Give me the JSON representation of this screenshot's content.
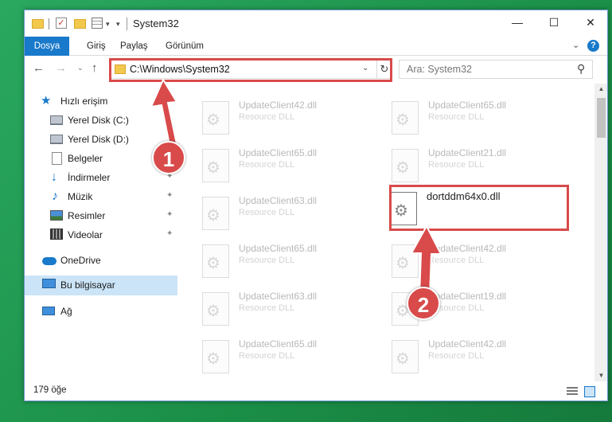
{
  "window": {
    "title": "System32",
    "controls": {
      "minimize": "—",
      "maximize": "☐",
      "close": "✕"
    },
    "quick_access_check": "✓"
  },
  "ribbon": {
    "tabs": [
      {
        "label": "Dosya",
        "active": true
      },
      {
        "label": "Giriş"
      },
      {
        "label": "Paylaş"
      },
      {
        "label": "Görünüm"
      }
    ],
    "help": "?",
    "collapse": "⌄"
  },
  "navbar": {
    "back": "←",
    "forward": "→",
    "recent": "⌄",
    "up": "↑",
    "address": "C:\\Windows\\System32",
    "address_dropdown": "⌄",
    "refresh": "↻",
    "search_placeholder": "Ara: System32",
    "search_icon": "⚲"
  },
  "sidebar": {
    "items": [
      {
        "label": "Hızlı erişim",
        "icon": "star-icon"
      },
      {
        "label": "Yerel Disk (C:)",
        "icon": "disk-icon",
        "pinned": true
      },
      {
        "label": "Yerel Disk (D:)",
        "icon": "disk-icon",
        "pinned": true
      },
      {
        "label": "Belgeler",
        "icon": "documents-icon",
        "pinned": true
      },
      {
        "label": "İndirmeler",
        "icon": "download-icon",
        "pinned": true
      },
      {
        "label": "Müzik",
        "icon": "music-icon",
        "pinned": true
      },
      {
        "label": "Resimler",
        "icon": "pictures-icon",
        "pinned": true
      },
      {
        "label": "Videolar",
        "icon": "videos-icon",
        "pinned": true
      },
      {
        "label": "OneDrive",
        "icon": "cloud-icon"
      },
      {
        "label": "Bu bilgisayar",
        "icon": "computer-icon",
        "selected": true
      },
      {
        "label": "Ağ",
        "icon": "network-icon"
      }
    ],
    "pin_glyph": "📌"
  },
  "files": [
    {
      "name": "UpdateClient42.dll",
      "type": "Resource DLL"
    },
    {
      "name": "UpdateClient65.dll",
      "type": "Resource DLL"
    },
    {
      "name": "UpdateClient65.dll",
      "type": "Resource DLL"
    },
    {
      "name": "UpdateClient21.dll",
      "type": "Resource DLL"
    },
    {
      "name": "UpdateClient63.dll",
      "type": "Resource DLL"
    },
    {
      "name": "dortddm64x0.dll",
      "type": ""
    },
    {
      "name": "UpdateClient65.dll",
      "type": "Resource DLL"
    },
    {
      "name": "UpdateClient42.dll",
      "type": "Resource DLL"
    },
    {
      "name": "UpdateClient63.dll",
      "type": "Resource DLL"
    },
    {
      "name": "UpdateClient19.dll",
      "type": "Resource DLL"
    },
    {
      "name": "UpdateClient65.dll",
      "type": "Resource DLL"
    },
    {
      "name": "UpdateClient42.dll",
      "type": "Resource DLL"
    }
  ],
  "status": {
    "count": "179 öğe"
  },
  "annotations": {
    "badge_1": "1",
    "badge_2": "2",
    "color": "#d94a4a"
  },
  "scroll": {
    "up": "▲",
    "down": "▼"
  }
}
